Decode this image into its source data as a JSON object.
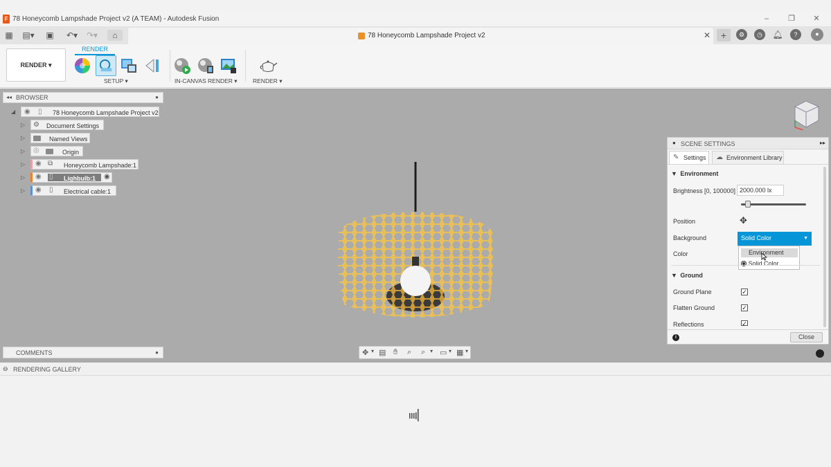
{
  "window": {
    "title": "78 Honeycomb Lampshade Project v2 (A TEAM) - Autodesk Fusion"
  },
  "tab": {
    "title": "78 Honeycomb Lampshade Project v2",
    "close": "✕",
    "add": "+"
  },
  "ribbon": {
    "workspace": "RENDER ▾",
    "active_tab": "RENDER",
    "groups": [
      {
        "label": "SETUP ▾"
      },
      {
        "label": "IN-CANVAS RENDER ▾"
      },
      {
        "label": "RENDER ▾"
      }
    ]
  },
  "browser": {
    "title": "BROWSER",
    "root": "78 Honeycomb Lampshade Project v2",
    "items": [
      {
        "label": "Document Settings",
        "icon": "gear-icon"
      },
      {
        "label": "Named Views",
        "icon": "folder-icon"
      },
      {
        "label": "Origin",
        "icon": "folder-icon"
      },
      {
        "label": "Honeycomb Lampshade:1",
        "icon": "component-icon",
        "color": "#e8a0a8"
      },
      {
        "label": "Lighbulb:1",
        "icon": "component-icon",
        "color": "#e8812a"
      },
      {
        "label": "Electrical cable:1",
        "icon": "component-icon",
        "color": "#5b8fd6"
      }
    ]
  },
  "comments": {
    "title": "COMMENTS"
  },
  "scene": {
    "title": "SCENE SETTINGS",
    "tabs": [
      {
        "label": "Settings"
      },
      {
        "label": "Environment Library"
      }
    ],
    "environment_section": "Environment",
    "brightness_label": "Brightness [0, 100000]",
    "brightness_value": "2000.000 lx",
    "brightness_fraction": 0.02,
    "position_label": "Position",
    "background_label": "Background",
    "background_value": "Solid Color",
    "color_label": "Color",
    "dropdown": {
      "options": [
        "Environment",
        "Solid Color"
      ],
      "selected": "Solid Color",
      "hovered": "Environment"
    },
    "ground_section": "Ground",
    "ground_plane_label": "Ground Plane",
    "flatten_ground_label": "Flatten Ground",
    "reflections_label": "Reflections",
    "close": "Close"
  },
  "gallery": {
    "title": "RENDERING GALLERY"
  },
  "colors": {
    "accent": "#0696d7",
    "viewport": "#ababab",
    "lampshade": "#e9bf5a"
  }
}
